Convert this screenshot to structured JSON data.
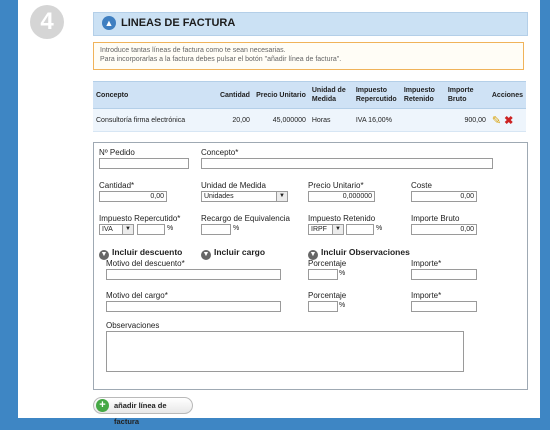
{
  "step_number": "4",
  "section_title": "LINEAS DE FACTURA",
  "notice": {
    "line1": "Introduce tantas líneas de factura como te sean necesarias.",
    "line2": "Para incorporarlas a la factura debes pulsar el botón \"añadir línea de factura\"."
  },
  "table": {
    "headers": [
      "Concepto",
      "Cantidad",
      "Precio Unitario",
      "Unidad de Medida",
      "Impuesto Repercutido",
      "Impuesto Retenido",
      "Importe Bruto",
      "Acciones"
    ],
    "rows": [
      {
        "concepto": "Consultoría firma electrónica",
        "cantidad": "20,00",
        "precio": "45,000000",
        "unidad": "Horas",
        "impuesto_rep": "IVA  16,00%",
        "impuesto_ret": "",
        "importe": "900,00"
      }
    ]
  },
  "form": {
    "pedido_label": "Nº Pedido",
    "concepto_label": "Concepto*",
    "cantidad_label": "Cantidad*",
    "cantidad_value": "0,00",
    "unidad_label": "Unidad de Medida",
    "unidad_value": "Unidades",
    "precio_label": "Precio Unitario*",
    "precio_value": "0,000000",
    "coste_label": "Coste",
    "coste_value": "0,00",
    "imp_rep_label": "Impuesto Repercutido*",
    "imp_rep_value": "IVA",
    "recargo_label": "Recargo de Equivalencia",
    "imp_ret_label": "Impuesto Retenido",
    "imp_ret_value": "IRPF",
    "importe_bruto_label": "Importe Bruto",
    "importe_bruto_value": "0,00",
    "pct_symbol": "%",
    "incluir_descuento": "Incluir descuento",
    "incluir_cargo": "Incluir cargo",
    "incluir_observaciones": "Incluir Observaciones",
    "motivo_descuento_label": "Motivo del descuento*",
    "porcentaje_label": "Porcentaje",
    "importe_label": "Importe*",
    "motivo_cargo_label": "Motivo del cargo*",
    "observaciones_label": "Observaciones"
  },
  "add_button_label": "añadir línea de factura",
  "colors": {
    "background": "#3e86c4",
    "title_bar": "#cbe1f4",
    "notice_border": "#f0b35a"
  }
}
